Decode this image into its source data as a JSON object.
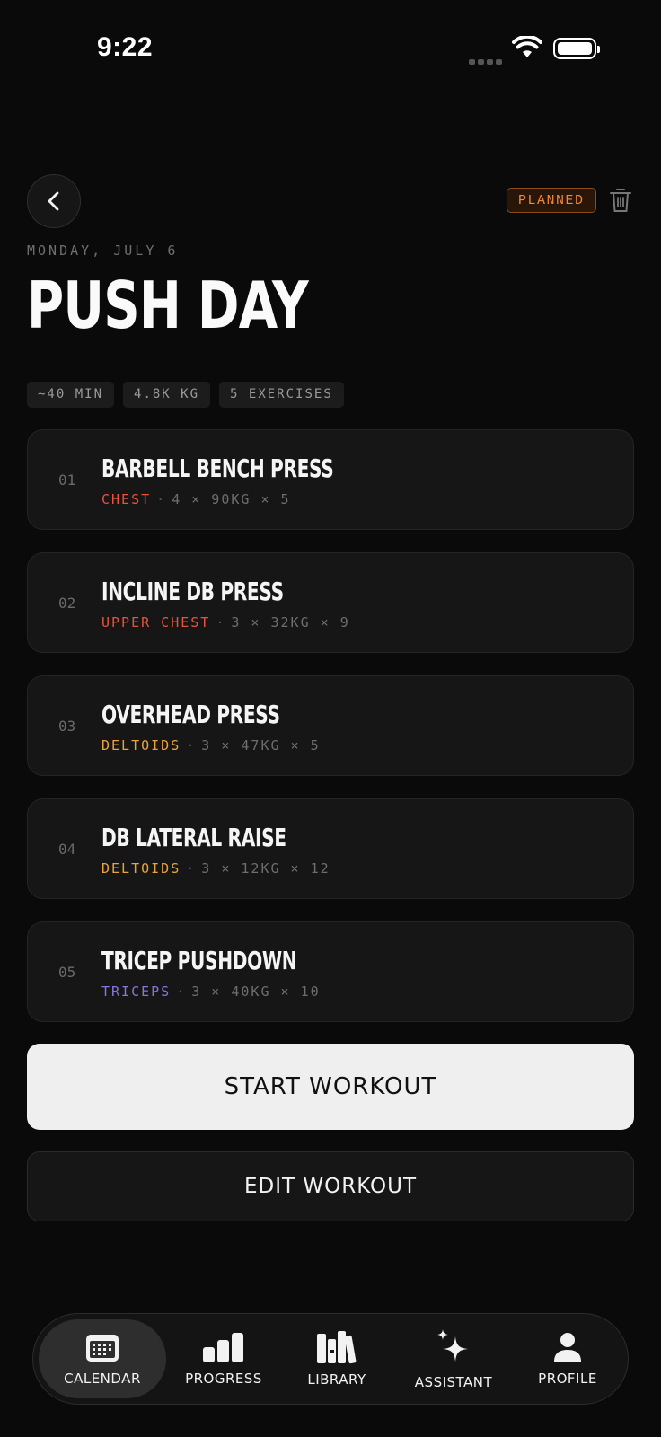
{
  "status": {
    "time": "9:22"
  },
  "header": {
    "badge": "PLANNED",
    "date": "MONDAY, JULY 6",
    "title": "PUSH DAY"
  },
  "chips": [
    "~40 MIN",
    "4.8K KG",
    "5 EXERCISES"
  ],
  "exercises": [
    {
      "num": "01",
      "name": "BARBELL BENCH PRESS",
      "muscle": "CHEST",
      "muscle_color": "#e5533d",
      "detail": "4 × 90KG × 5"
    },
    {
      "num": "02",
      "name": "INCLINE DB PRESS",
      "muscle": "UPPER CHEST",
      "muscle_color": "#e5533d",
      "detail": "3 × 32KG × 9"
    },
    {
      "num": "03",
      "name": "OVERHEAD PRESS",
      "muscle": "DELTOIDS",
      "muscle_color": "#e8a33c",
      "detail": "3 × 47KG × 5"
    },
    {
      "num": "04",
      "name": "DB LATERAL RAISE",
      "muscle": "DELTOIDS",
      "muscle_color": "#e8a33c",
      "detail": "3 × 12KG × 12"
    },
    {
      "num": "05",
      "name": "TRICEP PUSHDOWN",
      "muscle": "TRICEPS",
      "muscle_color": "#8a72e0",
      "detail": "3 × 40KG × 10"
    }
  ],
  "actions": {
    "start": "START WORKOUT",
    "edit": "EDIT WORKOUT"
  },
  "tabs": [
    {
      "label": "CALENDAR",
      "icon": "calendar-icon"
    },
    {
      "label": "PROGRESS",
      "icon": "bar-chart-icon"
    },
    {
      "label": "LIBRARY",
      "icon": "books-icon"
    },
    {
      "label": "ASSISTANT",
      "icon": "sparkle-icon"
    },
    {
      "label": "PROFILE",
      "icon": "person-icon"
    }
  ]
}
